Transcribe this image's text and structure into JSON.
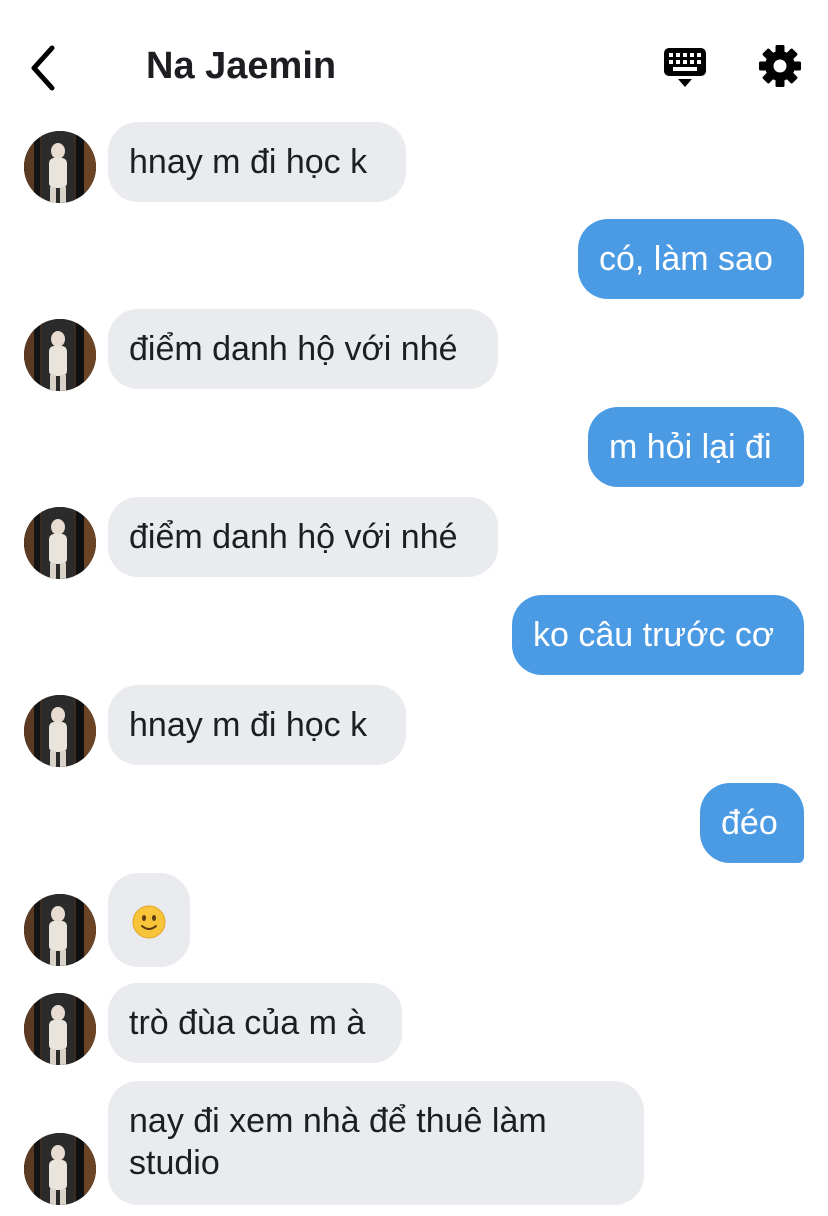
{
  "header": {
    "title": "Na Jaemin"
  },
  "messages": [
    {
      "side": "in",
      "text": "hnay m đi học k"
    },
    {
      "side": "out",
      "text": "có, làm sao"
    },
    {
      "side": "in",
      "text": "điểm danh hộ với nhé"
    },
    {
      "side": "out",
      "text": "m hỏi lại đi"
    },
    {
      "side": "in",
      "text": "điểm danh hộ với nhé"
    },
    {
      "side": "out",
      "text": "ko câu trước cơ"
    },
    {
      "side": "in",
      "text": "hnay m đi học k"
    },
    {
      "side": "out",
      "text": "đéo"
    },
    {
      "side": "in",
      "emoji": "slightly-smiling-face"
    },
    {
      "side": "in",
      "text": "trò đùa của m à"
    },
    {
      "side": "in",
      "text": "nay đi xem nhà để thuê làm studio"
    }
  ],
  "colors": {
    "incoming_bubble": "#e9ebee",
    "outgoing_bubble": "#4b9be4",
    "title": "#1c1e21"
  }
}
